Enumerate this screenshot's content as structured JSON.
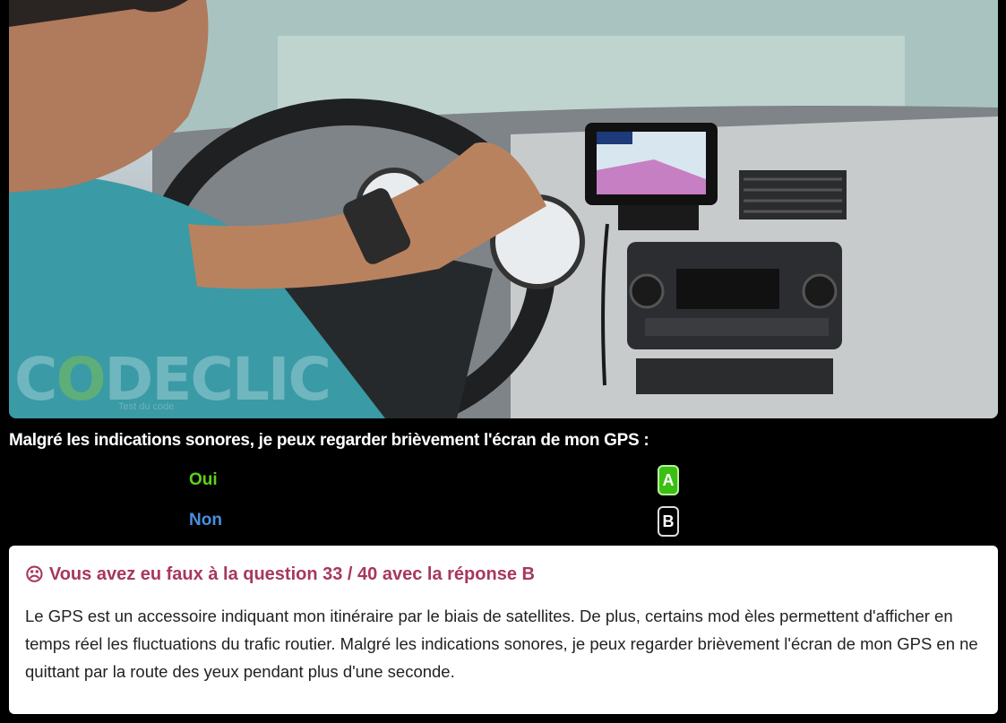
{
  "image": {
    "logo_text": "CODECLIC",
    "logo_tagline": "Test du code"
  },
  "question": {
    "text": "Malgré les indications sonores, je peux regarder brièvement l'écran de mon GPS :",
    "answers": [
      {
        "label": "Oui",
        "key": "A",
        "color": "#5bd31a",
        "state": "correct"
      },
      {
        "label": "Non",
        "key": "B",
        "color": "#4a8fe0",
        "state": "selected"
      }
    ]
  },
  "result": {
    "icon": "sad-face-icon",
    "title": "Vous avez eu faux à la question 33 / 40 avec la réponse B",
    "title_color": "#a7385a",
    "explanation": "Le GPS est un accessoire indiquant mon itinéraire par le biais de satellites. De plus, certains mod    èles permettent d'afficher en temps réel les fluctuations du trafic routier. Malgré les indications sonores, je peux regarder brièvement l'écran de mon GPS en ne quittant par la route des yeux pendant plus d'une seconde."
  }
}
